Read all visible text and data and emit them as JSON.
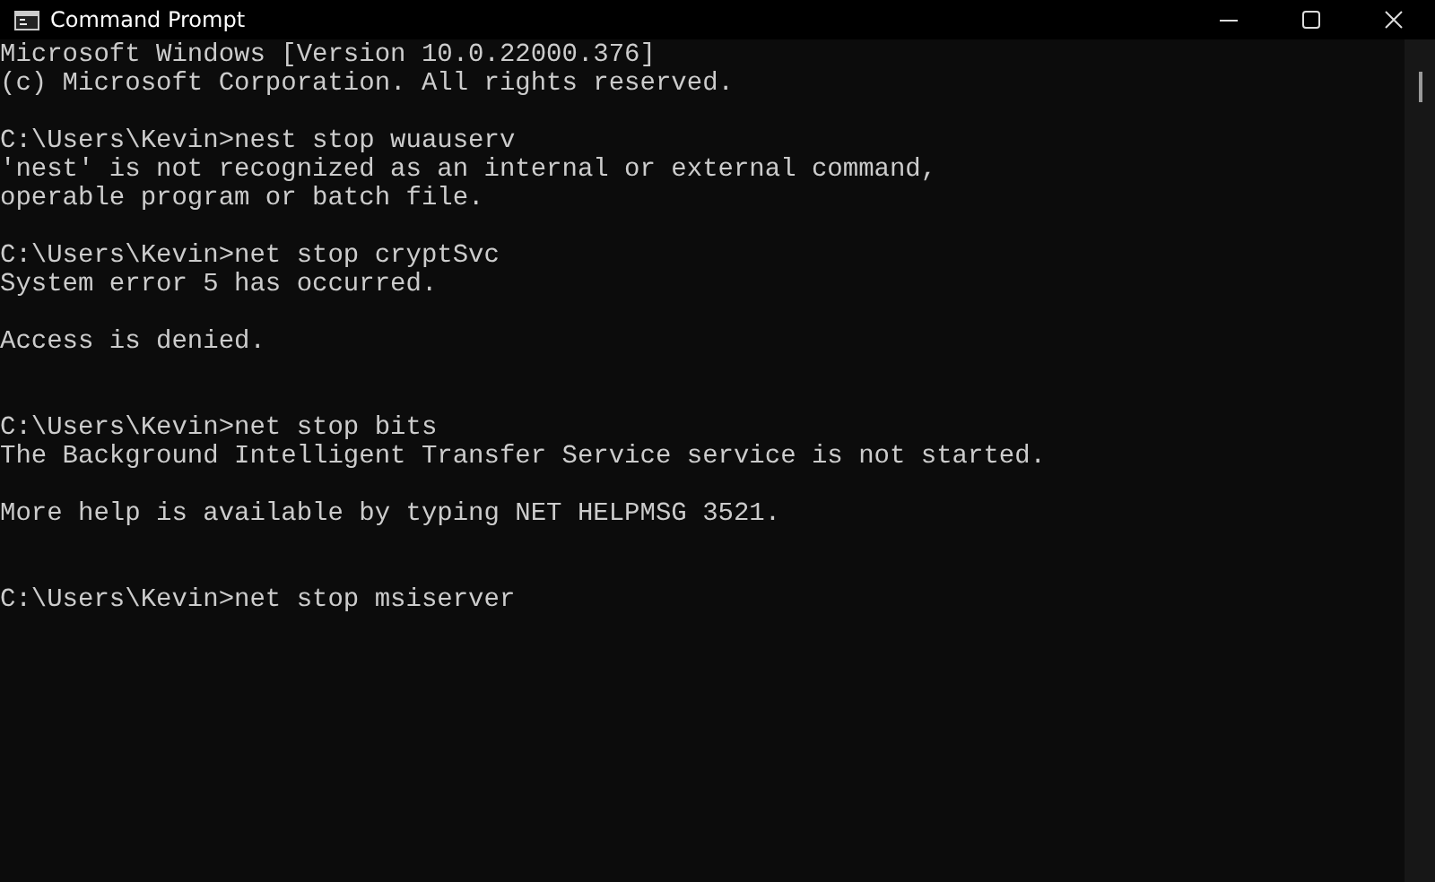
{
  "window": {
    "title": "Command Prompt"
  },
  "console": {
    "lines": [
      {
        "kind": "text",
        "text": "Microsoft Windows [Version 10.0.22000.376]"
      },
      {
        "kind": "text",
        "text": "(c) Microsoft Corporation. All rights reserved."
      },
      {
        "kind": "blank"
      },
      {
        "kind": "text",
        "text": "C:\\Users\\Kevin>nest stop wuauserv"
      },
      {
        "kind": "text",
        "text": "'nest' is not recognized as an internal or external command,"
      },
      {
        "kind": "text",
        "text": "operable program or batch file."
      },
      {
        "kind": "blank"
      },
      {
        "kind": "text",
        "text": "C:\\Users\\Kevin>net stop cryptSvc"
      },
      {
        "kind": "text",
        "text": "System error 5 has occurred."
      },
      {
        "kind": "blank"
      },
      {
        "kind": "text",
        "text": "Access is denied."
      },
      {
        "kind": "blank"
      },
      {
        "kind": "blank"
      },
      {
        "kind": "text",
        "text": "C:\\Users\\Kevin>net stop bits"
      },
      {
        "kind": "text",
        "text": "The Background Intelligent Transfer Service service is not started."
      },
      {
        "kind": "blank"
      },
      {
        "kind": "text",
        "text": "More help is available by typing NET HELPMSG 3521."
      },
      {
        "kind": "blank"
      },
      {
        "kind": "blank"
      },
      {
        "kind": "text",
        "text": "C:\\Users\\Kevin>net stop msiserver"
      }
    ]
  }
}
